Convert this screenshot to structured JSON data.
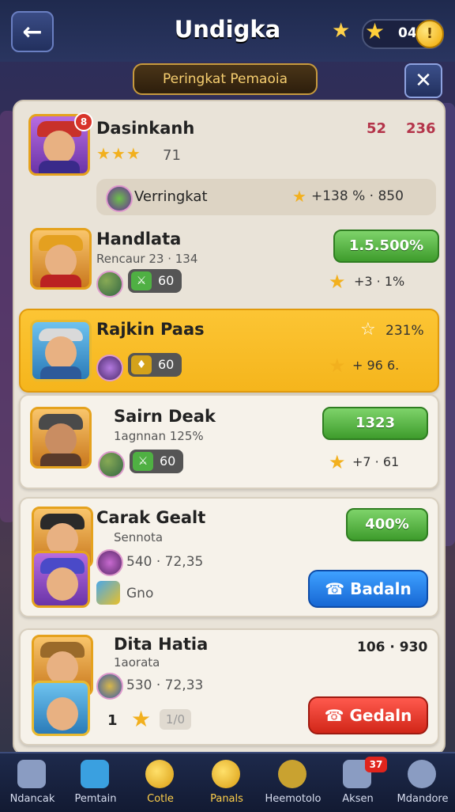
{
  "header": {
    "title": "Undigka",
    "currency_value": "04",
    "back_icon": "arrow-left-icon",
    "close_icon": "close-icon"
  },
  "subtitle": "Peringkat Pemaoia",
  "top_entry": {
    "name": "Dasinkanh",
    "level_badge": "8",
    "stars_text": "71",
    "score_a": "52",
    "score_b": "236",
    "subrow_label": "Verringkat",
    "subrow_value": "+138  % · 850"
  },
  "entries": [
    {
      "name": "Handlata",
      "subtitle": "Rencaur 23 · 134",
      "chip_value": "60",
      "right_pill": "1.5.500%",
      "bottom_stats": "+3 · 1%"
    },
    {
      "name": "Rajkin Paas",
      "chip_value": "60",
      "top_right": "231%",
      "bottom_stats": "+ 96 6."
    },
    {
      "name": "Sairn Deak",
      "subtitle": "1agnnan 125%",
      "chip_value": "60",
      "right_pill": "1323",
      "bottom_stats": "+7 · 61"
    },
    {
      "name": "Carak Gealt",
      "subtitle": "Sennota",
      "stats_line": "540 · 72,35",
      "label_line": "Gno",
      "right_pill": "400%",
      "button_label": "Badaln"
    },
    {
      "name": "Dita Hatia",
      "subtitle": "1aorata",
      "stats_line": "530 · 72,33",
      "rank_number": "1",
      "chip_value": "1/0",
      "top_right": "106 · 930",
      "button_label": "Gedaln"
    }
  ],
  "bottom_nav": [
    {
      "label": "Ndancak",
      "icon": "home-icon"
    },
    {
      "label": "Pemtain",
      "icon": "grid-icon"
    },
    {
      "label": "Cotle",
      "icon": "avatar-icon",
      "active": true
    },
    {
      "label": "Panals",
      "icon": "check-badge-icon",
      "active": true
    },
    {
      "label": "Heemotolo",
      "icon": "medal-icon"
    },
    {
      "label": "Aksen",
      "icon": "chat-icon",
      "badge": "37"
    },
    {
      "label": "Mdandore",
      "icon": "profile-icon"
    }
  ],
  "colors": {
    "highlight": "#fcc534",
    "green": "#3e9c2c",
    "blue": "#1767d4",
    "red": "#d12618"
  }
}
